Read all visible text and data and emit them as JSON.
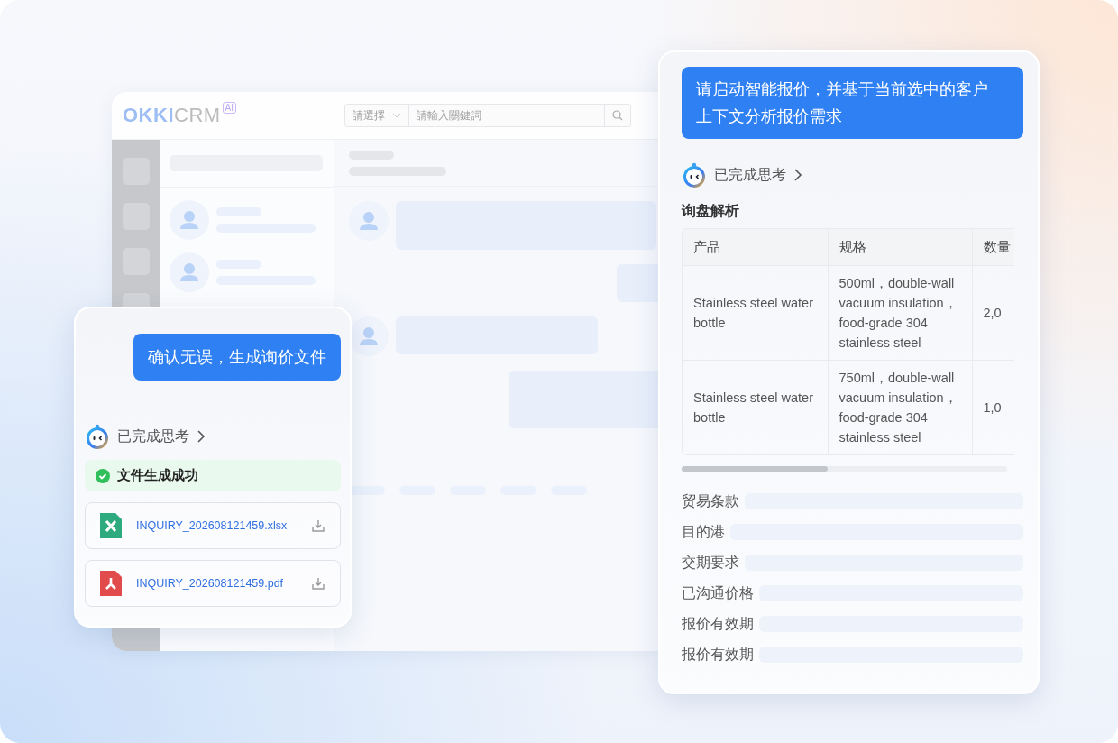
{
  "app_window": {
    "logo_main": "OKKI",
    "logo_suffix": "CRM",
    "logo_badge": "AI",
    "search": {
      "select": "請選擇",
      "placeholder": "請輸入關鍵詞"
    }
  },
  "left_card": {
    "user_message": "确认无误，生成询价文件",
    "thinking": "已完成思考",
    "status": {
      "kind": "success",
      "text": "文件生成成功"
    },
    "files": [
      {
        "kind": "excel",
        "name": "INQUIRY_202608121459.xlsx"
      },
      {
        "kind": "pdf",
        "name": "INQUIRY_202608121459.pdf"
      }
    ]
  },
  "right_card": {
    "user_message": "请启动智能报价，并基于当前选中的客户上下文分析报价需求",
    "thinking": "已完成思考",
    "section_title": "询盘解析",
    "table": {
      "columns": [
        "产品",
        "规格",
        "数量"
      ],
      "rows": [
        {
          "cells": [
            "Stainless steel water bottle",
            "500ml，double-wall vacuum insulation，food-grade 304 stainless steel",
            "2,0"
          ]
        },
        {
          "cells": [
            "Stainless steel water bottle",
            "750ml，double-wall vacuum insulation，food-grade 304 stainless steel",
            "1,0"
          ]
        }
      ]
    },
    "fields": [
      {
        "label": "贸易条款"
      },
      {
        "label": "目的港"
      },
      {
        "label": "交期要求"
      },
      {
        "label": "已沟通价格"
      },
      {
        "label": "报价有效期"
      },
      {
        "label": "报价有效期"
      }
    ]
  }
}
